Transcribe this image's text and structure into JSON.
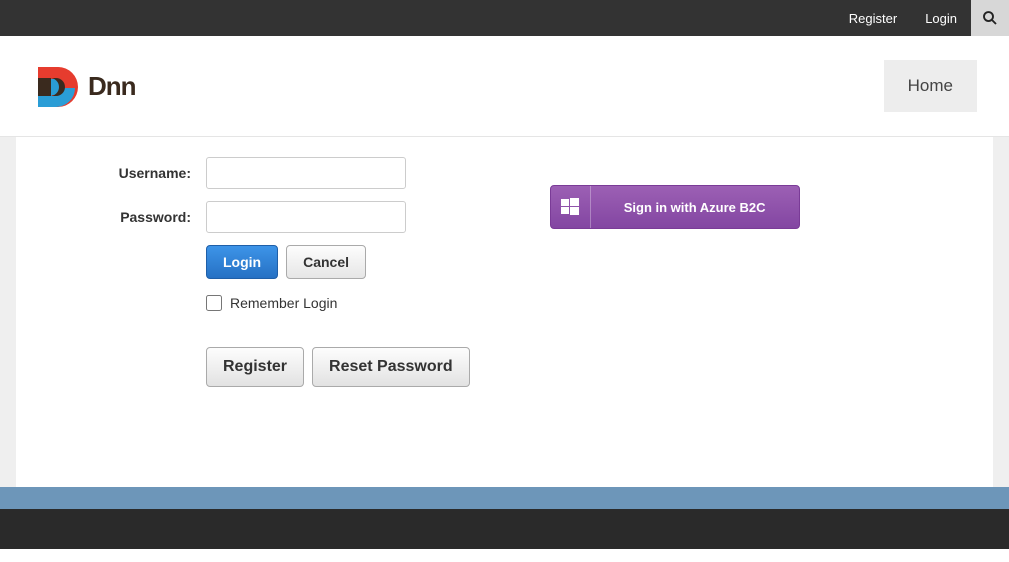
{
  "topbar": {
    "register": "Register",
    "login": "Login"
  },
  "logo": {
    "text": "Dnn"
  },
  "nav": {
    "home": "Home"
  },
  "login_form": {
    "username_label": "Username:",
    "password_label": "Password:",
    "username_value": "",
    "password_value": "",
    "login_button": "Login",
    "cancel_button": "Cancel",
    "remember_label": "Remember Login",
    "register_button": "Register",
    "reset_button": "Reset Password"
  },
  "azure": {
    "button_label": "Sign in with Azure B2C"
  }
}
